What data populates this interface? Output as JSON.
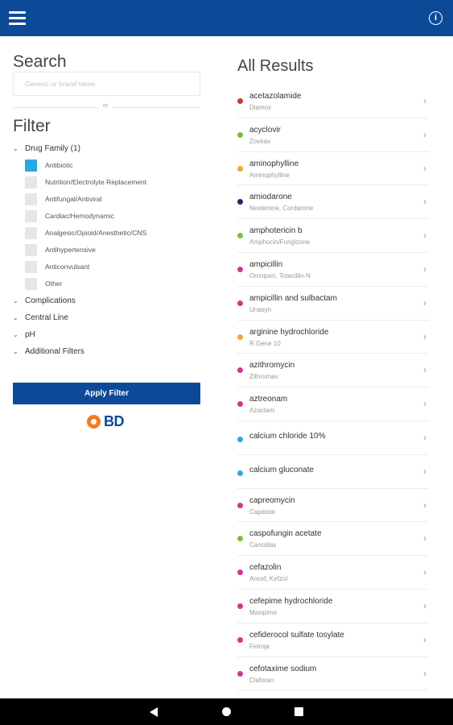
{
  "header": {
    "menu_icon": "hamburger-menu-icon",
    "info_icon": "info-circle-icon",
    "info_glyph": "i",
    "color": "#0c4a97"
  },
  "search": {
    "title": "Search",
    "placeholder": "Generic or brand name",
    "or_text": "or"
  },
  "filter": {
    "title": "Filter",
    "sections": [
      {
        "label": "Drug Family (1)",
        "expanded": true
      },
      {
        "label": "Complications",
        "expanded": false
      },
      {
        "label": "Central Line",
        "expanded": false
      },
      {
        "label": "pH",
        "expanded": false
      },
      {
        "label": "Additional Filters",
        "expanded": false
      }
    ],
    "chevron": "⌄",
    "drug_family_options": [
      {
        "label": "Antibiotic",
        "checked": true
      },
      {
        "label": "Nutrition/Electrolyte Replacement",
        "checked": false
      },
      {
        "label": "Antifungal/Antiviral",
        "checked": false
      },
      {
        "label": "Cardiac/Hemodynamic",
        "checked": false
      },
      {
        "label": "Analgesic/Opioid/Anesthetic/CNS",
        "checked": false
      },
      {
        "label": "Antihypertensive",
        "checked": false
      },
      {
        "label": "Anticonvulsant",
        "checked": false
      },
      {
        "label": "Other",
        "checked": false
      }
    ],
    "apply_label": "Apply Filter"
  },
  "logo": {
    "text": "BD",
    "mark_color": "#f07c22"
  },
  "results": {
    "title": "All Results",
    "arrow": "›",
    "items": [
      {
        "name": "acetazolamide",
        "brand": "Diamox",
        "color": "#c8382f"
      },
      {
        "name": "acyclovir",
        "brand": "Zovirax",
        "color": "#7bbf3a"
      },
      {
        "name": "aminophylline",
        "brand": "Aminophylline",
        "color": "#f2a62c"
      },
      {
        "name": "amiodarone",
        "brand": "Nexterone, Cordarone",
        "color": "#1a2a6c"
      },
      {
        "name": "amphotericin b",
        "brand": "Amphocin/Fungizone",
        "color": "#7bbf3a"
      },
      {
        "name": "ampicillin",
        "brand": "Omnipen, Totacillin-N",
        "color": "#d6338f"
      },
      {
        "name": "ampicillin and sulbactam",
        "brand": "Unasyn",
        "color": "#d6338f"
      },
      {
        "name": "arginine hydrochloride",
        "brand": "R Gene 10",
        "color": "#f2a62c"
      },
      {
        "name": "azithromycin",
        "brand": "Zithromax",
        "color": "#d6338f"
      },
      {
        "name": "aztreonam",
        "brand": "Azactam",
        "color": "#d6338f"
      },
      {
        "name": "calcium chloride 10%",
        "brand": "",
        "color": "#2aa8e0"
      },
      {
        "name": "calcium gluconate",
        "brand": "",
        "color": "#2aa8e0"
      },
      {
        "name": "capreomycin",
        "brand": "Capastat",
        "color": "#d6338f"
      },
      {
        "name": "caspofungin acetate",
        "brand": "Cancidas",
        "color": "#7bbf3a"
      },
      {
        "name": "cefazolin",
        "brand": "Ancef, Kefzol",
        "color": "#d6338f"
      },
      {
        "name": "cefepime hydrochloride",
        "brand": "Maxipime",
        "color": "#d6338f"
      },
      {
        "name": "cefiderocol sulfate tosylate",
        "brand": "Fetroja",
        "color": "#d6338f"
      },
      {
        "name": "cefotaxime sodium",
        "brand": "Claforan",
        "color": "#d6338f"
      }
    ]
  },
  "navbar": {
    "back_icon": "back-triangle-icon",
    "home_icon": "home-circle-icon",
    "recent_icon": "recent-apps-square-icon"
  }
}
